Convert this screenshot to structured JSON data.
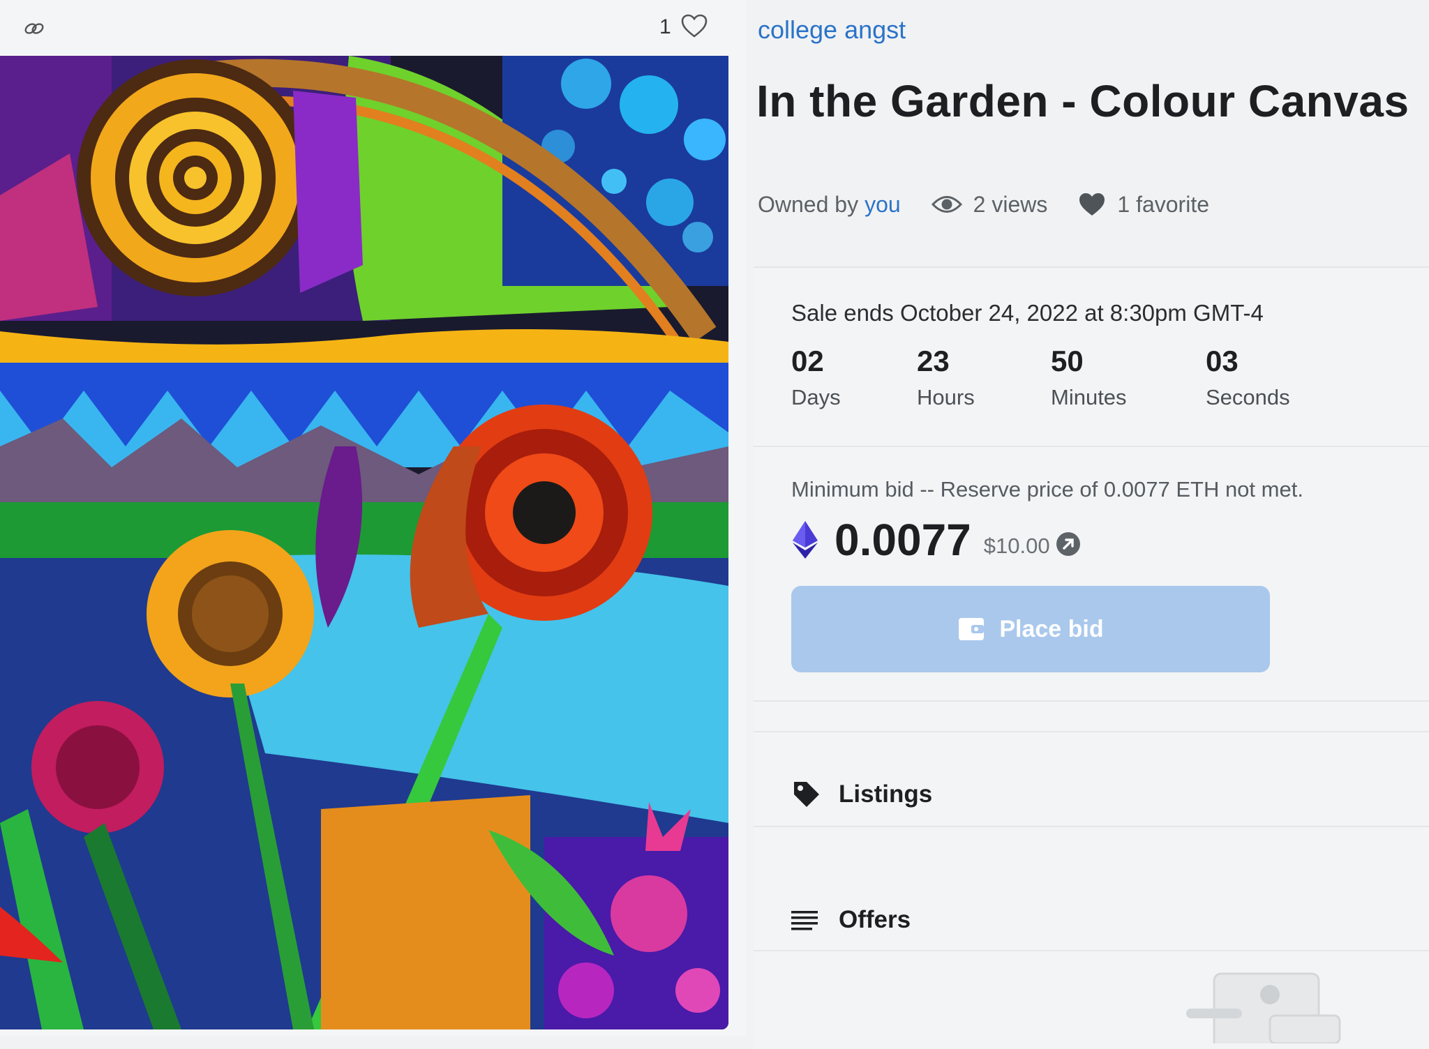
{
  "topbar": {
    "favorite_count": "1"
  },
  "item": {
    "collection": "college angst",
    "title": "In the Garden - Colour Canvas",
    "owned_by_label": "Owned by",
    "owner": "you",
    "views": "2 views",
    "favorites": "1 favorite"
  },
  "sale": {
    "ends": "Sale ends October 24, 2022 at 8:30pm GMT-4",
    "countdown": [
      {
        "value": "02",
        "label": "Days"
      },
      {
        "value": "23",
        "label": "Hours"
      },
      {
        "value": "50",
        "label": "Minutes"
      },
      {
        "value": "03",
        "label": "Seconds"
      }
    ],
    "min_bid_note": "Minimum bid -- Reserve price of 0.0077 ETH not met.",
    "price_eth": "0.0077",
    "price_usd": "$10.00",
    "place_bid_label": "Place bid"
  },
  "sections": {
    "listings": "Listings",
    "offers": "Offers"
  },
  "colors": {
    "link": "#2a73c9",
    "button": "#a9c8ec",
    "eth": "#4a3bd6"
  }
}
